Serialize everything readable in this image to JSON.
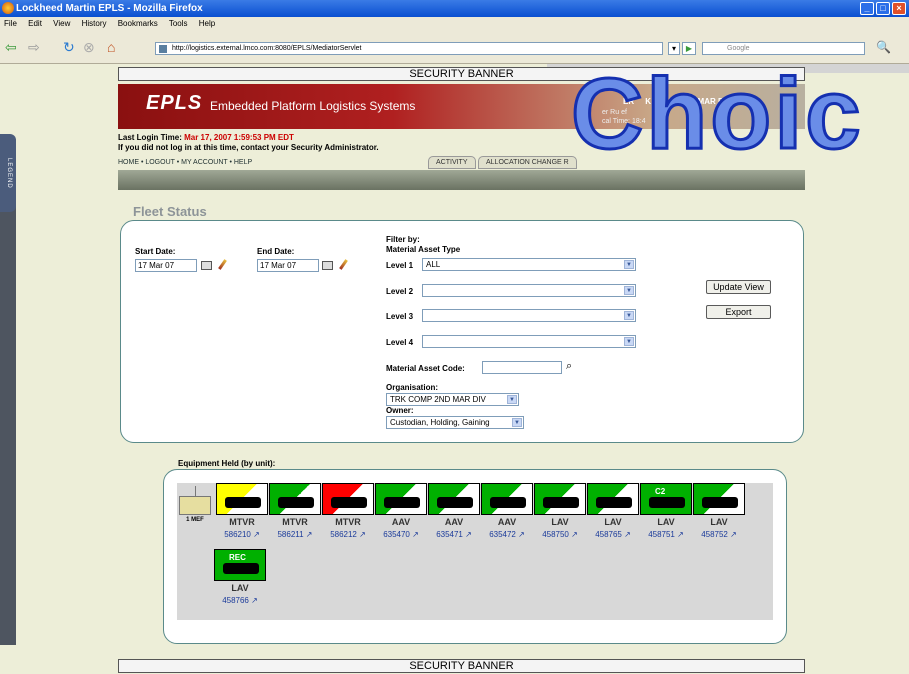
{
  "window": {
    "title": "Lockheed Martin EPLS - Mozilla Firefox",
    "controls": [
      "_",
      "□",
      "×"
    ]
  },
  "menu": [
    "File",
    "Edit",
    "View",
    "History",
    "Bookmarks",
    "Tools",
    "Help"
  ],
  "nav": {
    "url": "http://logistics.external.lmco.com:8080/EPLS/MediatorServlet",
    "search_placeholder": "Google"
  },
  "banner": {
    "top": "SECURITY BANNER",
    "bottom": "SECURITY BANNER"
  },
  "header": {
    "logo": "EPLS",
    "tagline": "Embedded Platform Logistics Systems",
    "role_partial": "ER",
    "org_partial": "K COMP 2ND MAR DIV",
    "line2": "er Ru",
    "line2b": "ef",
    "critical_time": "cal Time:",
    "critical_time_value": "18:4"
  },
  "login": {
    "label": "Last Login Time:",
    "value": "Mar 17, 2007 1:59:53 PM EDT",
    "notice": "If you did not log in at this time, contact your Security Administrator."
  },
  "topnav": "HOME • LOGOUT • MY ACCOUNT • HELP",
  "tabs": [
    "ACTIVITY",
    "ALLOCATION CHANGE R"
  ],
  "legend": "LEGEND",
  "page_title": "Fleet Status",
  "filters": {
    "start_label": "Start Date:",
    "start_value": "17 Mar 07",
    "end_label": "End Date:",
    "end_value": "17 Mar 07",
    "filter_by": "Filter by:",
    "asset_type": "Material Asset Type",
    "level1": "Level 1",
    "level1_value": "ALL",
    "level2": "Level 2",
    "level3": "Level 3",
    "level4": "Level 4",
    "asset_code": "Material Asset Code:",
    "organisation": "Organisation:",
    "organisation_value": "TRK COMP 2ND MAR DIV",
    "owner": "Owner:",
    "owner_value": "Custodian, Holding, Gaining",
    "update_btn": "Update View",
    "export_btn": "Export"
  },
  "equipment": {
    "title": "Equipment Held (by unit):",
    "mef": "1 MEF",
    "units": [
      {
        "name": "MTVR",
        "number": "586210",
        "status": "#ffff00",
        "badge": ""
      },
      {
        "name": "MTVR",
        "number": "586211",
        "status": "#00b000",
        "badge": ""
      },
      {
        "name": "MTVR",
        "number": "586212",
        "status": "#ff0000",
        "badge": ""
      },
      {
        "name": "AAV",
        "number": "635470",
        "status": "#00b000",
        "badge": ""
      },
      {
        "name": "AAV",
        "number": "635471",
        "status": "#00b000",
        "badge": ""
      },
      {
        "name": "AAV",
        "number": "635472",
        "status": "#00b000",
        "badge": ""
      },
      {
        "name": "LAV",
        "number": "458750",
        "status": "#00b000",
        "badge": ""
      },
      {
        "name": "LAV",
        "number": "458765",
        "status": "#00b000",
        "badge": ""
      },
      {
        "name": "LAV",
        "number": "458751",
        "status": "#00b000",
        "badge": "C2"
      },
      {
        "name": "LAV",
        "number": "458752",
        "status": "#00b000",
        "badge": ""
      },
      {
        "name": "LAV",
        "number": "458766",
        "status": "#00b000",
        "badge": "REC"
      }
    ]
  },
  "overlay": "Choic"
}
